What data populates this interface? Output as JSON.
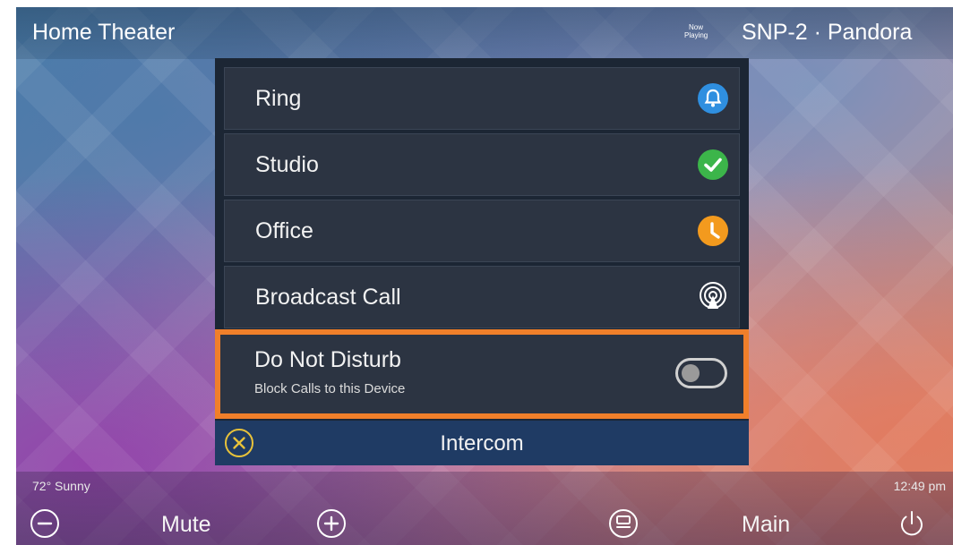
{
  "header": {
    "room": "Home Theater",
    "now_playing_badge": "Now Playing",
    "now_playing": "SNP-2 · Pandora"
  },
  "intercom": {
    "items": [
      {
        "label": "Ring",
        "icon": "bell-icon",
        "color": "#2f8fe0"
      },
      {
        "label": "Studio",
        "icon": "check-icon",
        "color": "#3cb54a"
      },
      {
        "label": "Office",
        "icon": "clock-icon",
        "color": "#f39a1e"
      },
      {
        "label": "Broadcast Call",
        "icon": "broadcast-icon",
        "color": "#ffffff"
      }
    ],
    "dnd": {
      "label": "Do Not Disturb",
      "sublabel": "Block Calls to this Device",
      "enabled": false,
      "highlight_color": "#f07f2a"
    },
    "title": "Intercom"
  },
  "status": {
    "weather": "72° Sunny",
    "time": "12:49 pm"
  },
  "controls": {
    "mute": "Mute",
    "main": "Main"
  }
}
